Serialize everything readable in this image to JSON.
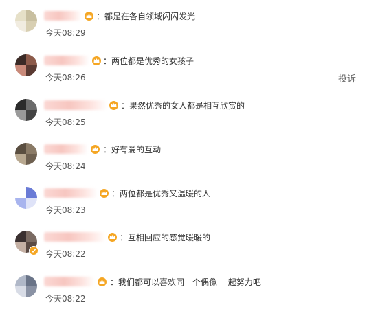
{
  "comments": [
    {
      "text": "：都是在各自领域闪闪发光",
      "time": "今天08:29",
      "colors": [
        "#e6e0c8",
        "#c8bfa0",
        "#f1ece0",
        "#d8cfb2"
      ]
    },
    {
      "text": "：两位都是优秀的女孩子",
      "time": "今天08:26",
      "colors": [
        "#3a2a26",
        "#8c5a4a",
        "#c98a7a",
        "#5a3a32"
      ]
    },
    {
      "text": "：果然优秀的女人都是相互欣赏的",
      "time": "今天08:25",
      "colors": [
        "#2b2b2b",
        "#6b6b6b",
        "#9a9a9a",
        "#444444"
      ]
    },
    {
      "text": "：好有爱的互动",
      "time": "今天08:24",
      "colors": [
        "#5a4e40",
        "#8a7a66",
        "#b8a890",
        "#6e6050"
      ]
    },
    {
      "text": "：两位都是优秀又温暖的人",
      "time": "今天08:23",
      "colors": [
        "#ffffff",
        "#6a7bd6",
        "#a8b4ee",
        "#dfe3f8"
      ]
    },
    {
      "text": "：互相回应的感觉暖暖的",
      "time": "今天08:22",
      "colors": [
        "#3a3030",
        "#7a6a62",
        "#c4b0a4",
        "#5a4a44"
      ]
    },
    {
      "text": "：我们都可以喜欢同一个偶像 一起努力吧",
      "time": "今天08:22",
      "colors": [
        "#b0b8c8",
        "#6a7488",
        "#d8dce6",
        "#8a92a4"
      ]
    }
  ],
  "report_label": "投诉",
  "icons": {
    "crown": "crown-icon",
    "verified": "verified-badge-icon"
  },
  "crown_color": "#f5a623"
}
